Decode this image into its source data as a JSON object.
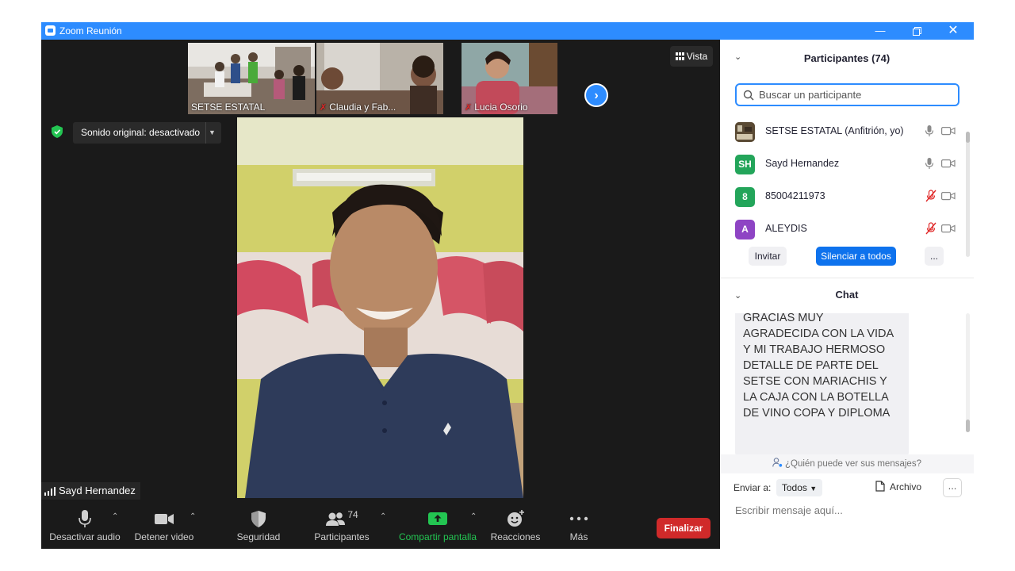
{
  "window": {
    "title": "Zoom Reunión"
  },
  "thumbnails": [
    {
      "name": "SETSE ESTATAL",
      "muted": false
    },
    {
      "name": "Claudia y Fab...",
      "muted": true
    },
    {
      "name": "Lucia Osorio",
      "muted": true
    }
  ],
  "view_button": "Vista",
  "sound_option": "Sonido original: desactivado",
  "active_speaker": "Sayd Hernandez",
  "toolbar": {
    "audio": "Desactivar audio",
    "video": "Detener video",
    "security": "Seguridad",
    "participants": "Participantes",
    "participant_count": "74",
    "share": "Compartir pantalla",
    "reactions": "Reacciones",
    "more": "Más",
    "end": "Finalizar"
  },
  "participants_panel": {
    "title": "Participantes (74)",
    "search_placeholder": "Buscar un participante",
    "list": [
      {
        "name": "SETSE ESTATAL (Anfitrión, yo)",
        "initials": "",
        "color": "#6b5a3c",
        "muted": false
      },
      {
        "name": "Sayd Hernandez",
        "initials": "SH",
        "color": "#23a55a",
        "muted": false
      },
      {
        "name": "85004211973",
        "initials": "8",
        "color": "#23a55a",
        "muted": true
      },
      {
        "name": "ALEYDIS",
        "initials": "A",
        "color": "#8e44c4",
        "muted": true
      }
    ],
    "invite": "Invitar",
    "mute_all": "Silenciar a todos",
    "more": "..."
  },
  "chat": {
    "title": "Chat",
    "message": "GRACIAS MUY AGRADECIDA CON LA VIDA Y MI TRABAJO HERMOSO DETALLE DE PARTE DEL SETSE CON MARIACHIS Y LA CAJA CON LA BOTELLA DE VINO COPA Y DIPLOMA",
    "who_sees": "¿Quién puede ver sus mensajes?",
    "send_to_label": "Enviar a:",
    "send_to_value": "Todos",
    "file": "Archivo",
    "more": "...",
    "input_placeholder": "Escribir mensaje aquí..."
  },
  "colors": {
    "accent": "#2d8cff",
    "end": "#d02a2a",
    "share": "#23c552",
    "muted": "#e02828"
  }
}
